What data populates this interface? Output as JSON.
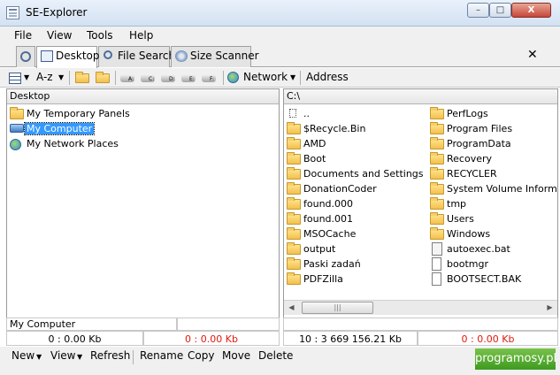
{
  "window": {
    "title": "SE-Explorer",
    "minimize_glyph": "–",
    "maximize_glyph": "□",
    "close_glyph": "X"
  },
  "menu": {
    "items": [
      "File",
      "View",
      "Tools",
      "Help"
    ]
  },
  "tabs": {
    "items": [
      {
        "label": "",
        "icon": "gear-icon"
      },
      {
        "label": "Desktop",
        "icon": "desktop-icon"
      },
      {
        "label": "File Search",
        "icon": "magnifier-icon"
      },
      {
        "label": "Size Scanner",
        "icon": "disk-icon"
      }
    ],
    "close_glyph": "✕"
  },
  "toolbar": {
    "sort_label": "A-z",
    "network_label": "Network",
    "address_label": "Address",
    "drives": [
      "A:",
      "C:",
      "D:",
      "E:",
      "F:"
    ]
  },
  "left_panel": {
    "header": "Desktop",
    "items": [
      {
        "label": "My Temporary Panels",
        "icon": "folder-icon"
      },
      {
        "label": "My Computer",
        "icon": "computer-icon",
        "selected": true
      },
      {
        "label": "My Network Places",
        "icon": "network-icon"
      }
    ],
    "status_text": "My Computer",
    "count_text": "0 : 0.00 Kb",
    "selected_count_text": "0 : 0.00 Kb"
  },
  "right_panel": {
    "header": "C:\\",
    "column1": [
      {
        "label": "..",
        "icon": "parent-dir-icon"
      },
      {
        "label": "$Recycle.Bin",
        "icon": "folder-icon"
      },
      {
        "label": "AMD",
        "icon": "folder-icon"
      },
      {
        "label": "Boot",
        "icon": "folder-icon"
      },
      {
        "label": "Documents and Settings",
        "icon": "folder-icon"
      },
      {
        "label": "DonationCoder",
        "icon": "folder-icon"
      },
      {
        "label": "found.000",
        "icon": "folder-icon"
      },
      {
        "label": "found.001",
        "icon": "folder-icon"
      },
      {
        "label": "MSOCache",
        "icon": "folder-icon"
      },
      {
        "label": "output",
        "icon": "folder-icon"
      },
      {
        "label": "Paski zadań",
        "icon": "folder-icon"
      },
      {
        "label": "PDFZilla",
        "icon": "folder-icon"
      }
    ],
    "column2": [
      {
        "label": "PerfLogs",
        "icon": "folder-icon"
      },
      {
        "label": "Program Files",
        "icon": "folder-icon"
      },
      {
        "label": "ProgramData",
        "icon": "folder-icon"
      },
      {
        "label": "Recovery",
        "icon": "folder-icon"
      },
      {
        "label": "RECYCLER",
        "icon": "folder-icon"
      },
      {
        "label": "System Volume Informa",
        "icon": "folder-icon"
      },
      {
        "label": "tmp",
        "icon": "folder-icon"
      },
      {
        "label": "Users",
        "icon": "folder-icon"
      },
      {
        "label": "Windows",
        "icon": "folder-icon"
      },
      {
        "label": "autoexec.bat",
        "icon": "batch-file-icon"
      },
      {
        "label": "bootmgr",
        "icon": "file-icon"
      },
      {
        "label": "BOOTSECT.BAK",
        "icon": "file-icon"
      }
    ],
    "count_text": "10 : 3 669 156.21 Kb",
    "selected_count_text": "0 : 0.00 Kb",
    "scroll_left": "◀",
    "scroll_right": "▶",
    "thumb_grip": "|||"
  },
  "commands": {
    "new": "New",
    "view": "View",
    "refresh": "Refresh",
    "rename": "Rename",
    "copy": "Copy",
    "move": "Move",
    "delete": "Delete"
  },
  "watermark": "programosy.pl",
  "colors": {
    "accent_selection": "#3399ff",
    "selected_count_text": "#e0190e"
  }
}
